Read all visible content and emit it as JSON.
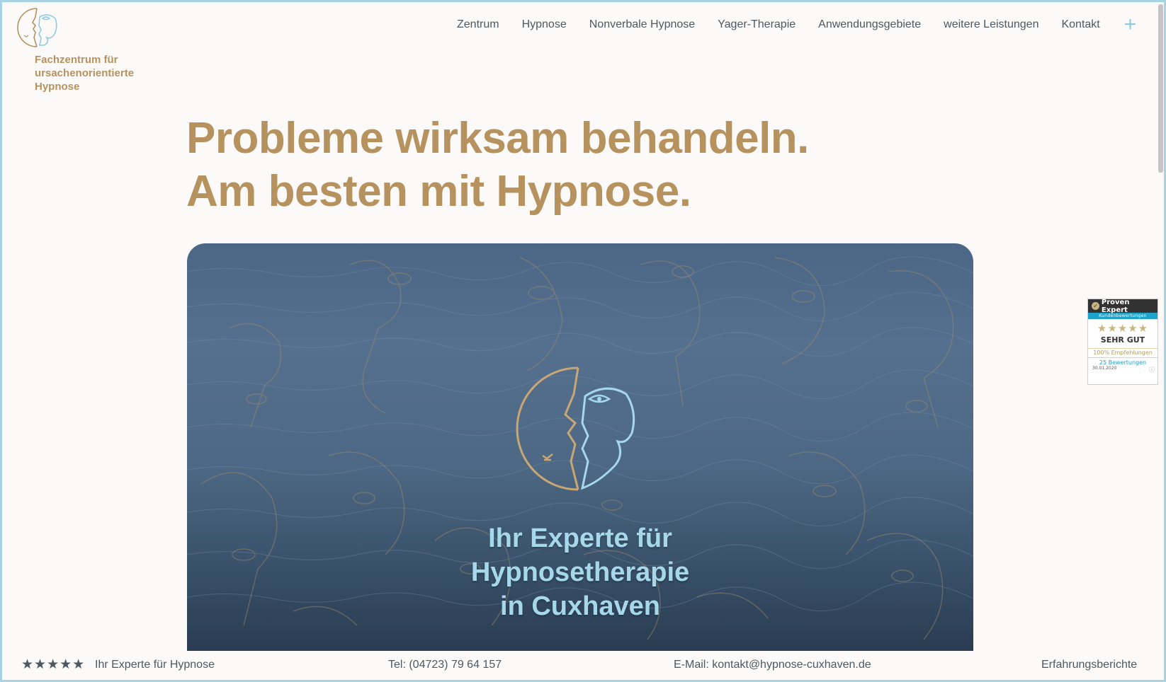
{
  "header": {
    "logo_text_lines": [
      "Fachzentrum für",
      "ursachenorientierte",
      "Hypnose"
    ]
  },
  "nav": {
    "items": [
      {
        "label": "Zentrum"
      },
      {
        "label": "Hypnose"
      },
      {
        "label": "Nonverbale Hypnose"
      },
      {
        "label": "Yager-Therapie"
      },
      {
        "label": "Anwendungsgebiete"
      },
      {
        "label": "weitere Leistungen"
      },
      {
        "label": "Kontakt"
      }
    ],
    "more_icon": "plus-icon"
  },
  "hero": {
    "headline_line1": "Probleme wirksam behandeln.",
    "headline_line2": "Am besten mit Hypnose.",
    "caption_lines": [
      "Ihr Experte für",
      "Hypnosetherapie",
      "in Cuxhaven"
    ]
  },
  "proven_expert": {
    "brand": "Proven Expert",
    "subtitle": "Kundenbewertungen",
    "stars": "★★★★★",
    "grade": "SEHR GUT",
    "recommendations": "100% Empfehlungen",
    "reviews": "25 Bewertungen",
    "date": "30.01.2020"
  },
  "footer": {
    "stars": "★★★★★",
    "tagline": "Ihr Experte für Hypnose",
    "phone": "Tel: (04723) 79 64 157",
    "email": "E-Mail: kontakt@hypnose-cuxhaven.de",
    "testimonials": "Erfahrungsberichte"
  },
  "colors": {
    "gold": "#b6925f",
    "light_blue": "#a6d8ec",
    "text_dark": "#4d5962",
    "background": "#fcfaf8"
  }
}
